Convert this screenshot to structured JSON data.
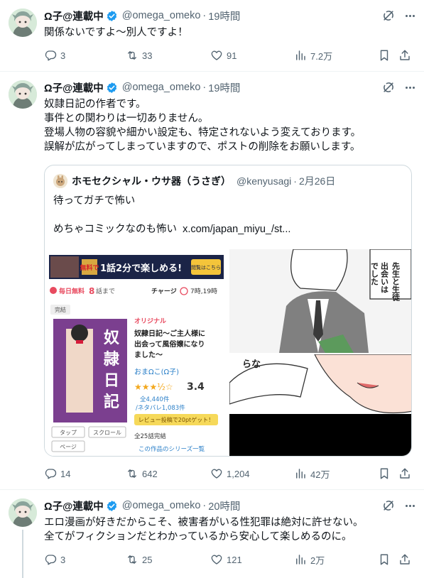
{
  "icons": {
    "reply": "reply-icon",
    "repost": "repost-icon",
    "like": "heart-icon",
    "views": "views-icon",
    "bookmark": "bookmark-icon",
    "share": "share-icon",
    "grok": "grok-icon",
    "more": "more-icon",
    "verified": "verified-badge-icon"
  },
  "colors": {
    "verified": "#1d9bf0",
    "text": "#0f1419",
    "muted": "#536471",
    "border": "#cfd9de"
  },
  "posts": [
    {
      "author": "Ω子@連載中",
      "handle": "@omega_omeko",
      "time": "19時間",
      "lines": [
        "関係ないですよ～別人ですよ！"
      ],
      "stats": {
        "replies": "3",
        "reposts": "33",
        "likes": "91",
        "views": "7.2万"
      }
    },
    {
      "author": "Ω子@連載中",
      "handle": "@omega_omeko",
      "time": "19時間",
      "lines": [
        "奴隷日記の作者です。",
        "事件との関わりは一切ありません。",
        "登場人物の容貌や細かい設定も、特定されないよう変えております。",
        "誤解が広がってしまっていますので、ポストの削除をお願いします。"
      ],
      "quote": {
        "author": "ホモセクシャル・ウサ器（うさぎ）",
        "handle": "@kenyusagi",
        "time": "2月26日",
        "line1": "待ってガチで怖い",
        "line2_text": "めちゃコミックなのも怖い",
        "line2_link": "x.com/japan_miyu_/st..."
      },
      "media": {
        "banner_text": "無料で",
        "banner_big": "1話2分で楽しめる!",
        "banner_btn": "閲覧はこちら",
        "free_label": "毎日無料",
        "free_count": "8",
        "free_suffix": "話まで",
        "charge": "チャージ",
        "charge_time": "7時,19時",
        "complete": "完結",
        "original": "オリジナル",
        "title": "奴隷日記〜ご主人様に出会って風俗嬢になりました〜",
        "title_l1": "奴隷日記〜ご主人様に",
        "title_l2": "出会って風俗嬢になり",
        "title_l3": "ました〜",
        "author": "おまΩこ(Ω子)",
        "rating": "3.4",
        "reviews": "全4,440件",
        "spoilers": "/ネタバレ1,083件",
        "review_cta": "レビュー投稿で20ptゲット！",
        "volumes": "全25話完結",
        "series": "この作品のシリーズ一覧",
        "btn_tap": "タップ",
        "btn_scroll": "スクロール",
        "btn_page": "ページ",
        "cover_big": "奴隷日記",
        "manga_top_text": "出会いは先生と生徒でした",
        "manga_bottom_text": "らな"
      },
      "stats": {
        "replies": "14",
        "reposts": "642",
        "likes": "1,204",
        "views": "42万"
      }
    },
    {
      "author": "Ω子@連載中",
      "handle": "@omega_omeko",
      "time": "20時間",
      "lines": [
        "エロ漫画が好きだからこそ、被害者がいる性犯罪は絶対に許せない。",
        "全てがフィクションだとわかっているから安心して楽しめるのに。"
      ],
      "stats": {
        "replies": "3",
        "reposts": "25",
        "likes": "121",
        "views": "2万"
      }
    }
  ]
}
